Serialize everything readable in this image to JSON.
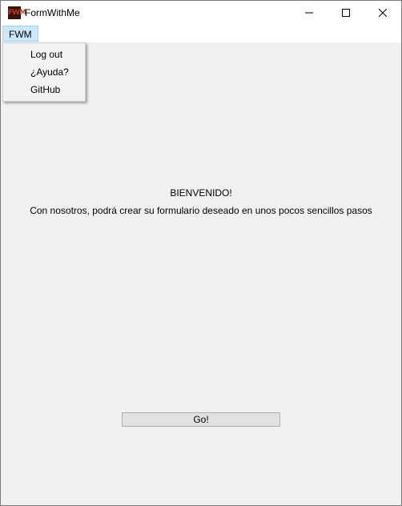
{
  "window": {
    "title": "FormWithMe",
    "icon": "fwm-app-logo",
    "icon_text": "FWM",
    "controls": [
      "minimize-icon",
      "maximize-icon",
      "close-icon"
    ]
  },
  "menubar": {
    "items": [
      {
        "label": "FWM",
        "state": "open"
      }
    ]
  },
  "dropdown": {
    "items": [
      {
        "label": "Log out"
      },
      {
        "label": "¿Ayuda?"
      },
      {
        "label": "GitHub"
      }
    ]
  },
  "main": {
    "heading": "BIENVENIDO!",
    "subtitle": "Con nosotros, podrá crear su formulario deseado en unos pocos sencillos pasos",
    "go_button_label": "Go!"
  },
  "colors": {
    "window_bg": "#f0f0f0",
    "menu_highlight": "#cce8ff",
    "logo_red": "#c4321c"
  }
}
